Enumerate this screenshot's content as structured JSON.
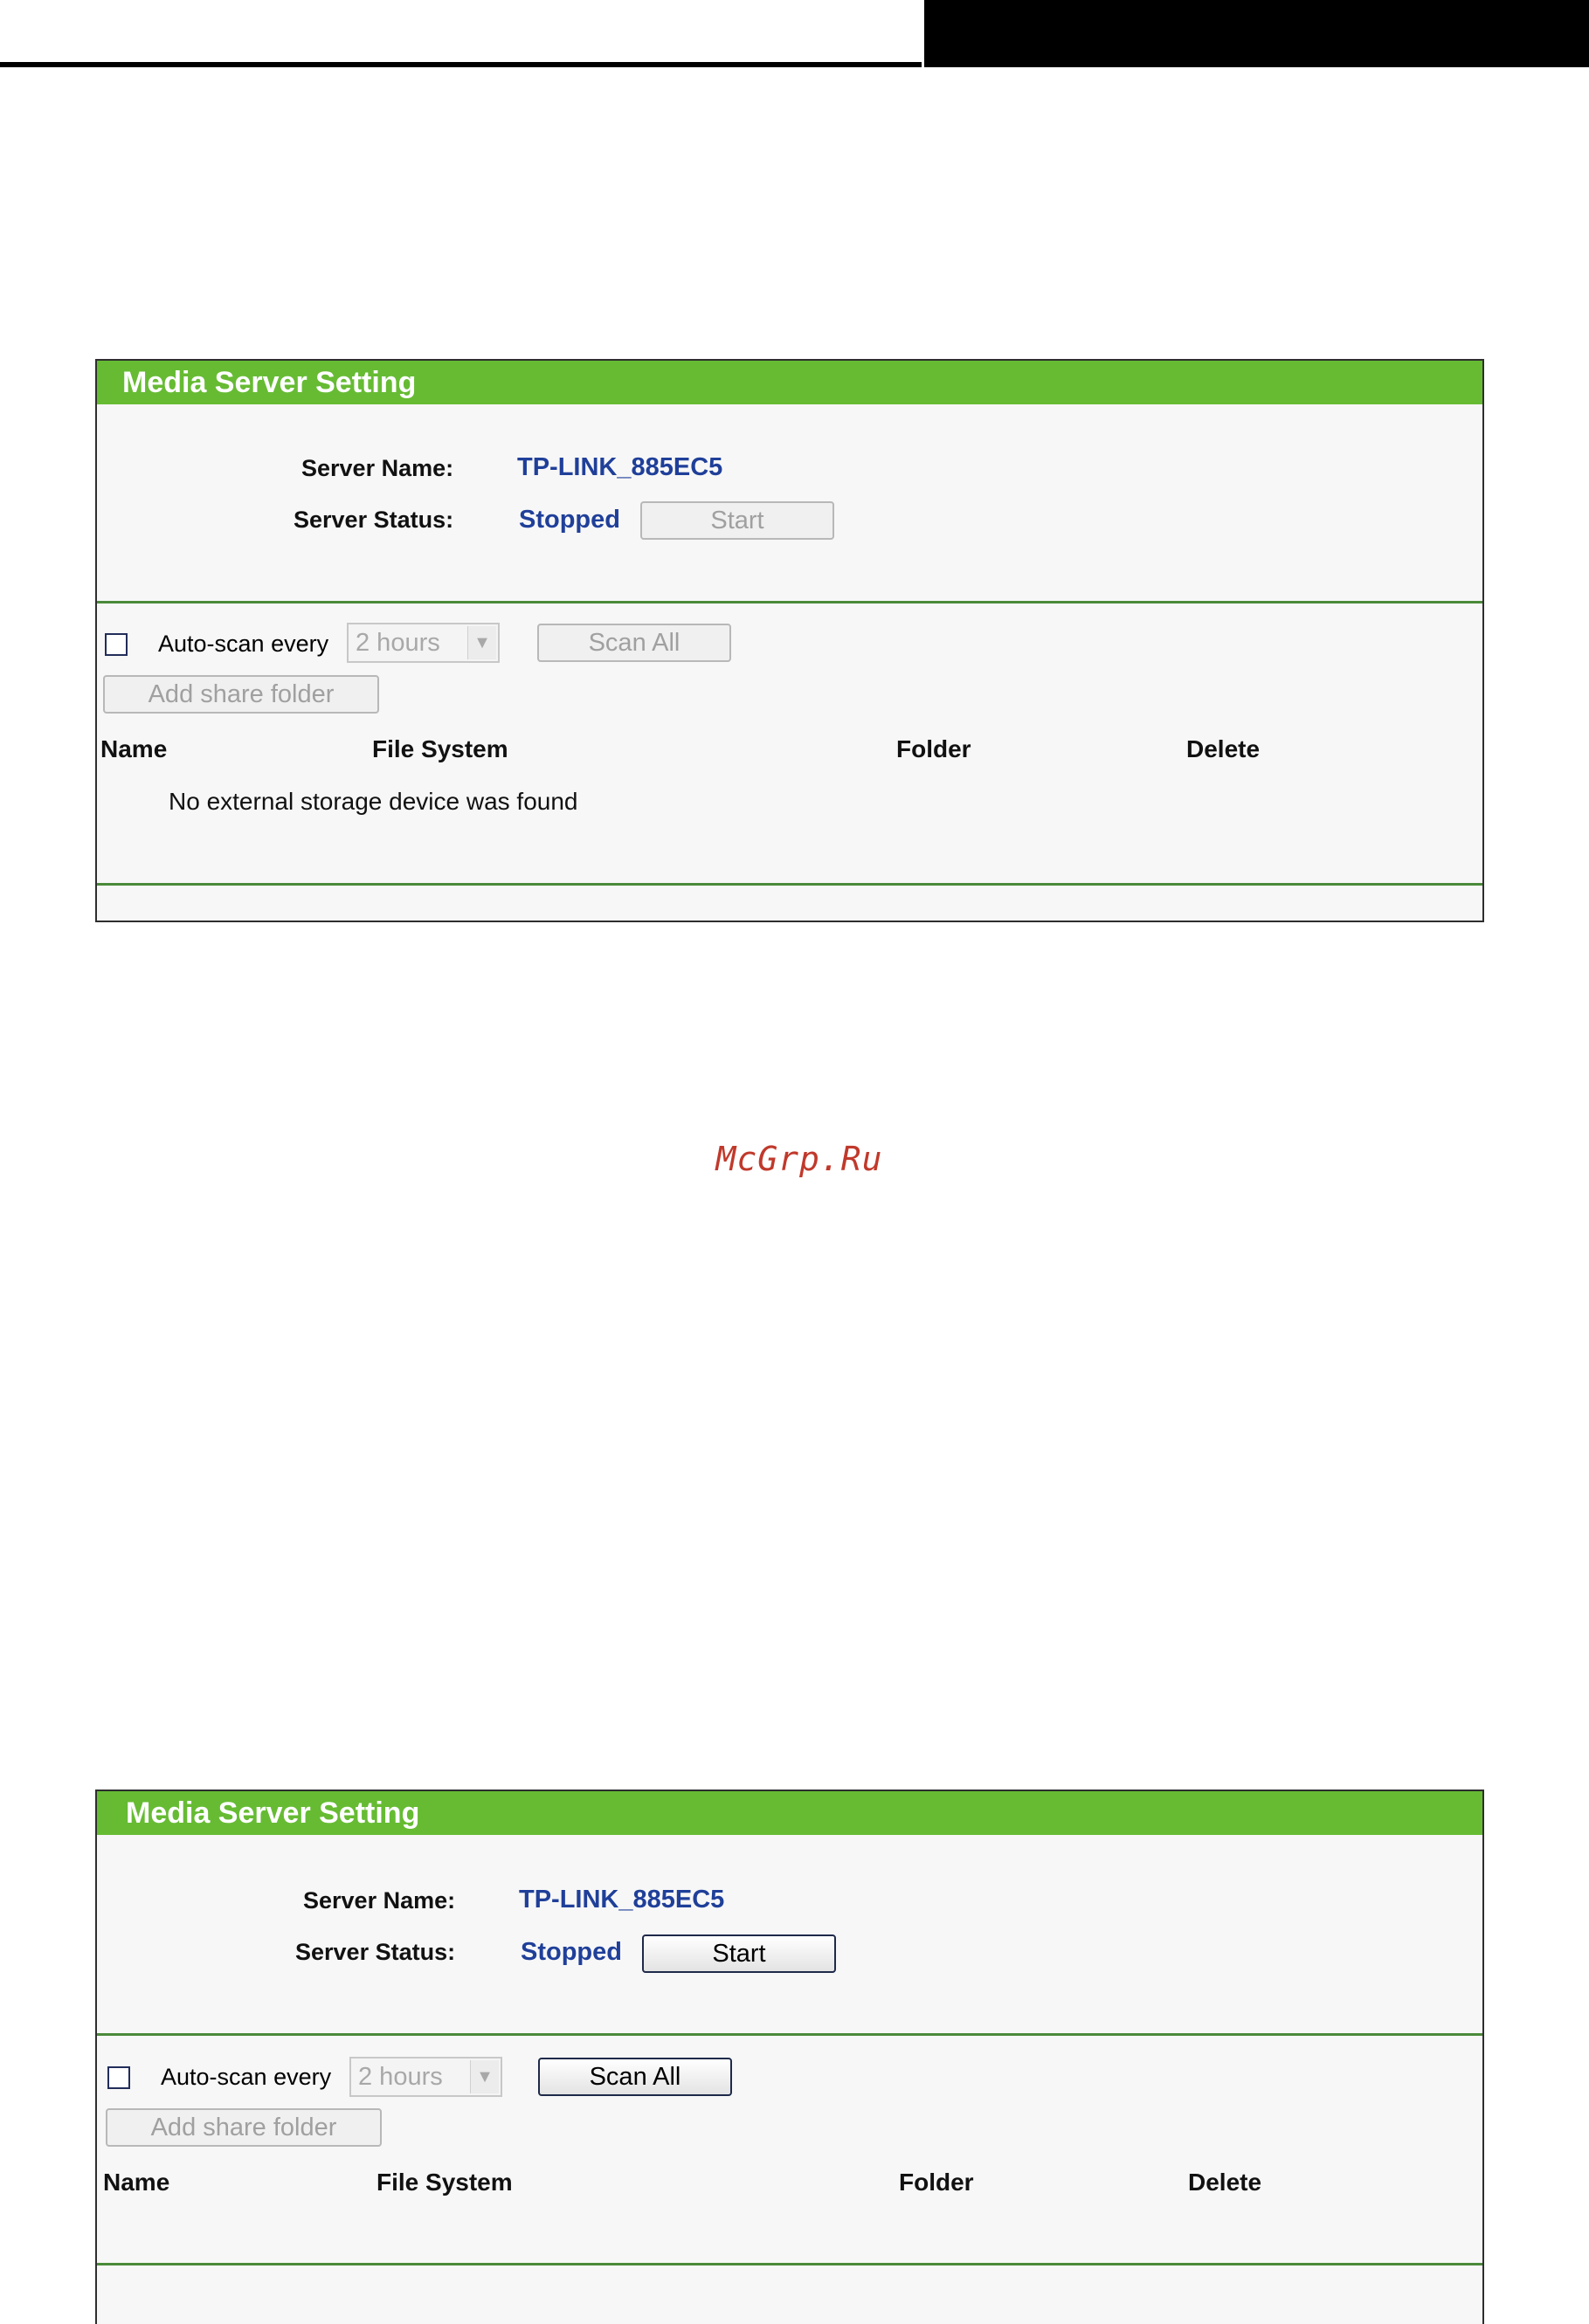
{
  "watermark": "McGrp.Ru",
  "panels": [
    {
      "title": "Media Server Setting",
      "server_name_label": "Server Name:",
      "server_name_value": "TP-LINK_885EC5",
      "server_status_label": "Server Status:",
      "server_status_value": "Stopped",
      "start_button": "Start",
      "start_enabled": false,
      "autoscan_label": "Auto-scan every",
      "autoscan_checked": false,
      "autoscan_interval": "2 hours",
      "scan_all_button": "Scan All",
      "scan_all_enabled": false,
      "add_share_folder_button": "Add share folder",
      "columns": [
        "Name",
        "File System",
        "Folder",
        "Delete"
      ],
      "message": "No external storage device was found"
    },
    {
      "title": "Media Server Setting",
      "server_name_label": "Server Name:",
      "server_name_value": "TP-LINK_885EC5",
      "server_status_label": "Server Status:",
      "server_status_value": "Stopped",
      "start_button": "Start",
      "start_enabled": true,
      "autoscan_label": "Auto-scan every",
      "autoscan_checked": false,
      "autoscan_interval": "2 hours",
      "scan_all_button": "Scan All",
      "scan_all_enabled": true,
      "add_share_folder_button": "Add share folder",
      "columns": [
        "Name",
        "File System",
        "Folder",
        "Delete"
      ],
      "message": ""
    }
  ]
}
